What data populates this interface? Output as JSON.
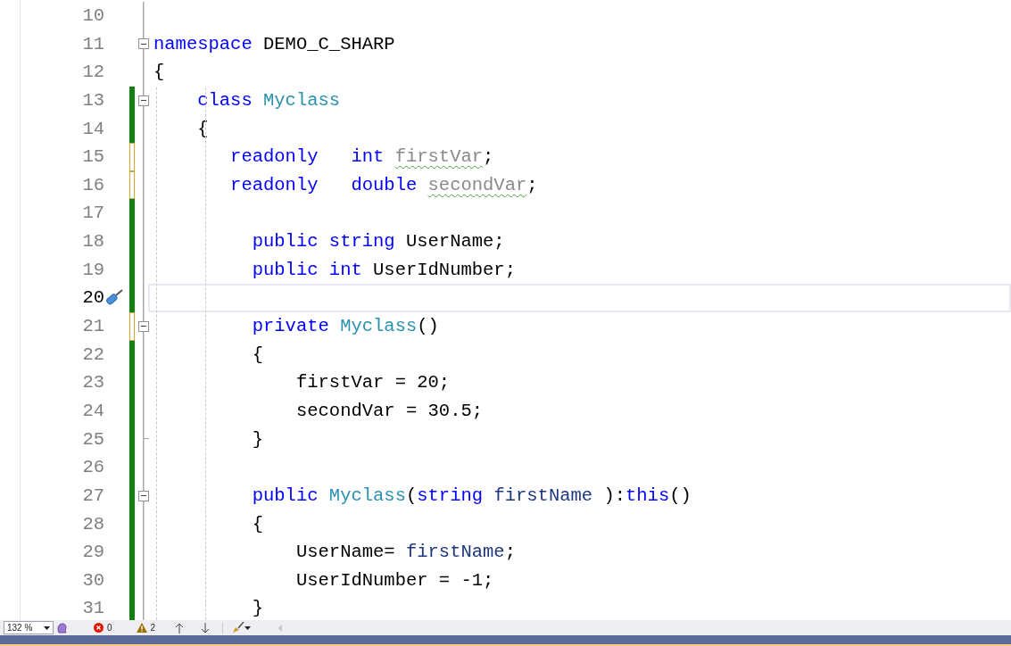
{
  "editor": {
    "lines": [
      {
        "number": "10",
        "change_bar": false,
        "collapsible": false,
        "fold_end": false,
        "current": false
      },
      {
        "number": "11",
        "change_bar": false,
        "collapsible": true,
        "fold_end": false,
        "current": false,
        "tokens": [
          {
            "kind": "keyword",
            "text": "namespace"
          },
          {
            "kind": "plain",
            "text": " DEMO_C_SHARP"
          }
        ]
      },
      {
        "number": "12",
        "change_bar": false,
        "collapsible": false,
        "fold_end": false,
        "current": false,
        "tokens": [
          {
            "kind": "plain",
            "text": "{"
          }
        ]
      },
      {
        "number": "13",
        "change_bar": true,
        "saved": true,
        "collapsible": true,
        "fold_end": false,
        "current": false,
        "tokens": [
          {
            "kind": "keyword",
            "text": "    class"
          },
          {
            "kind": "type",
            "text": " Myclass"
          }
        ]
      },
      {
        "number": "14",
        "change_bar": true,
        "saved": true,
        "collapsible": false,
        "fold_end": false,
        "current": false,
        "tokens": [
          {
            "kind": "plain",
            "text": "    {"
          }
        ]
      },
      {
        "number": "15",
        "change_bar": true,
        "saved": false,
        "collapsible": false,
        "fold_end": false,
        "current": false,
        "tokens": [
          {
            "kind": "keyword",
            "text": "       readonly"
          },
          {
            "kind": "keyword",
            "text": "   int "
          },
          {
            "kind": "unused",
            "text": "firstVar"
          },
          {
            "kind": "plain",
            "text": ";"
          }
        ]
      },
      {
        "number": "16",
        "change_bar": true,
        "saved": false,
        "collapsible": false,
        "fold_end": false,
        "current": false,
        "tokens": [
          {
            "kind": "keyword",
            "text": "       readonly"
          },
          {
            "kind": "keyword",
            "text": "   double "
          },
          {
            "kind": "unused",
            "text": "secondVar"
          },
          {
            "kind": "plain",
            "text": ";"
          }
        ]
      },
      {
        "number": "17",
        "change_bar": true,
        "saved": true,
        "collapsible": false,
        "fold_end": false,
        "current": false
      },
      {
        "number": "18",
        "change_bar": true,
        "saved": true,
        "collapsible": false,
        "fold_end": false,
        "current": false,
        "tokens": [
          {
            "kind": "keyword",
            "text": "         public"
          },
          {
            "kind": "keyword",
            "text": " string"
          },
          {
            "kind": "plain",
            "text": " UserName;"
          }
        ]
      },
      {
        "number": "19",
        "change_bar": true,
        "saved": true,
        "collapsible": false,
        "fold_end": false,
        "current": false,
        "tokens": [
          {
            "kind": "keyword",
            "text": "         public"
          },
          {
            "kind": "keyword",
            "text": " int"
          },
          {
            "kind": "plain",
            "text": " UserIdNumber;"
          }
        ]
      },
      {
        "number": "20",
        "change_bar": true,
        "saved": true,
        "collapsible": false,
        "fold_end": false,
        "current": true
      },
      {
        "number": "21",
        "change_bar": true,
        "saved": false,
        "collapsible": true,
        "fold_end": false,
        "current": false,
        "tokens": [
          {
            "kind": "keyword",
            "text": "         private"
          },
          {
            "kind": "type",
            "text": " Myclass"
          },
          {
            "kind": "plain",
            "text": "()"
          }
        ]
      },
      {
        "number": "22",
        "change_bar": true,
        "saved": true,
        "collapsible": false,
        "fold_end": false,
        "current": false,
        "tokens": [
          {
            "kind": "plain",
            "text": "         {"
          }
        ]
      },
      {
        "number": "23",
        "change_bar": true,
        "saved": true,
        "collapsible": false,
        "fold_end": false,
        "current": false,
        "tokens": [
          {
            "kind": "plain",
            "text": "             firstVar = 20;"
          }
        ]
      },
      {
        "number": "24",
        "change_bar": true,
        "saved": true,
        "collapsible": false,
        "fold_end": false,
        "current": false,
        "tokens": [
          {
            "kind": "plain",
            "text": "             secondVar = 30.5;"
          }
        ]
      },
      {
        "number": "25",
        "change_bar": true,
        "saved": true,
        "collapsible": false,
        "fold_end": true,
        "current": false,
        "tokens": [
          {
            "kind": "plain",
            "text": "         }"
          }
        ]
      },
      {
        "number": "26",
        "change_bar": true,
        "saved": true,
        "collapsible": false,
        "fold_end": false,
        "current": false
      },
      {
        "number": "27",
        "change_bar": true,
        "saved": true,
        "collapsible": true,
        "fold_end": false,
        "current": false,
        "tokens": [
          {
            "kind": "keyword",
            "text": "         public"
          },
          {
            "kind": "type",
            "text": " Myclass"
          },
          {
            "kind": "plain",
            "text": "("
          },
          {
            "kind": "keyword",
            "text": "string"
          },
          {
            "kind": "param",
            "text": " firstName"
          },
          {
            "kind": "plain",
            "text": " ):"
          },
          {
            "kind": "keyword",
            "text": "this"
          },
          {
            "kind": "plain",
            "text": "()"
          }
        ]
      },
      {
        "number": "28",
        "change_bar": true,
        "saved": true,
        "collapsible": false,
        "fold_end": false,
        "current": false,
        "tokens": [
          {
            "kind": "plain",
            "text": "         {"
          }
        ]
      },
      {
        "number": "29",
        "change_bar": true,
        "saved": true,
        "collapsible": false,
        "fold_end": false,
        "current": false,
        "tokens": [
          {
            "kind": "plain",
            "text": "             UserName= "
          },
          {
            "kind": "param",
            "text": "firstName"
          },
          {
            "kind": "plain",
            "text": ";"
          }
        ]
      },
      {
        "number": "30",
        "change_bar": true,
        "saved": true,
        "collapsible": false,
        "fold_end": false,
        "current": false,
        "tokens": [
          {
            "kind": "plain",
            "text": "             UserIdNumber = -1;"
          }
        ]
      },
      {
        "number": "31",
        "change_bar": true,
        "saved": true,
        "collapsible": false,
        "fold_end": false,
        "current": false,
        "tokens": [
          {
            "kind": "plain",
            "text": "         }"
          }
        ]
      }
    ]
  },
  "status_bar": {
    "zoom": "132 %",
    "errors": "0",
    "warnings": "2"
  }
}
